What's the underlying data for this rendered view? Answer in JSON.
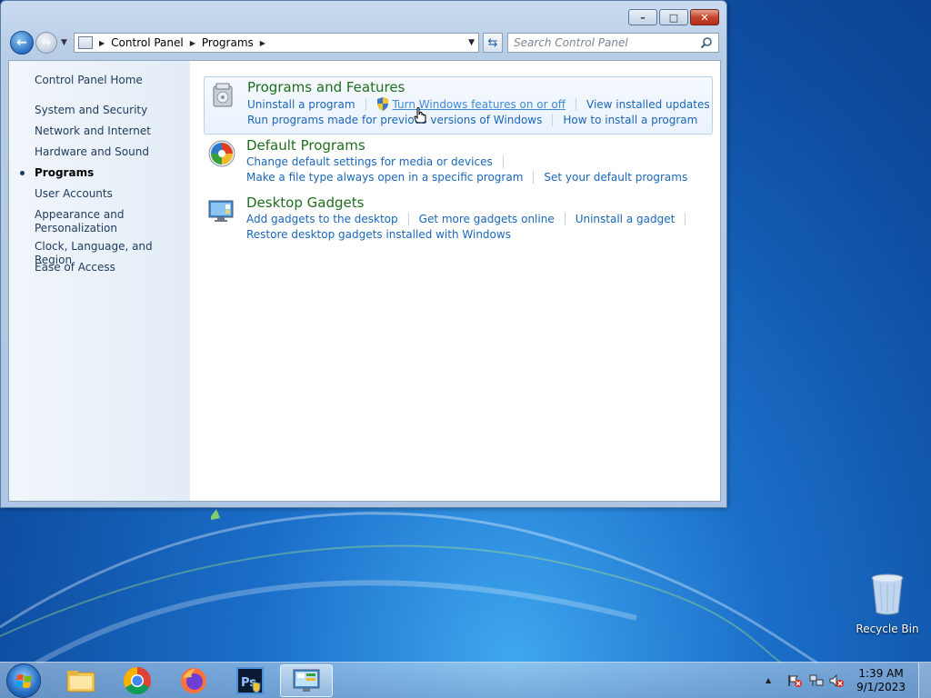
{
  "window": {
    "caption_buttons": {
      "minimize": "–",
      "maximize": "□",
      "close": "✕"
    },
    "address": {
      "crumbs": [
        "Control Panel",
        "Programs"
      ]
    },
    "search": {
      "placeholder": "Search Control Panel"
    }
  },
  "sidebar": {
    "home": "Control Panel Home",
    "items": [
      {
        "label": "System and Security"
      },
      {
        "label": "Network and Internet"
      },
      {
        "label": "Hardware and Sound"
      },
      {
        "label": "Programs",
        "active": true
      },
      {
        "label": "User Accounts"
      },
      {
        "label": "Appearance and Personalization",
        "line1": "Appearance and",
        "line2": "Personalization"
      },
      {
        "label": "Clock, Language, and Region"
      },
      {
        "label": "Ease of Access"
      }
    ]
  },
  "categories": [
    {
      "title": "Programs and Features",
      "icon": "programs-features-icon",
      "row1": [
        "Uninstall a program",
        "Turn Windows features on or off",
        "View installed updates"
      ],
      "row2": [
        "Run programs made for previous versions of Windows",
        "How to install a program"
      ]
    },
    {
      "title": "Default Programs",
      "icon": "default-programs-icon",
      "row1": [
        "Change default settings for media or devices"
      ],
      "row2": [
        "Make a file type always open in a specific program",
        "Set your default programs"
      ]
    },
    {
      "title": "Desktop Gadgets",
      "icon": "desktop-gadgets-icon",
      "row1": [
        "Add gadgets to the desktop",
        "Get more gadgets online",
        "Uninstall a gadget"
      ],
      "row2": [
        "Restore desktop gadgets installed with Windows"
      ]
    }
  ],
  "desktop": {
    "recycle_bin": "Recycle Bin"
  },
  "taskbar": {
    "apps": [
      "Windows Explorer",
      "Google Chrome",
      "Firefox",
      "Photoshop",
      "Control Panel"
    ],
    "clock": {
      "time": "1:39 AM",
      "date": "9/1/2023"
    }
  },
  "colors": {
    "link": "#1a66b8",
    "category_title": "#1e6e1e",
    "sidebar_text": "#1e395b"
  }
}
